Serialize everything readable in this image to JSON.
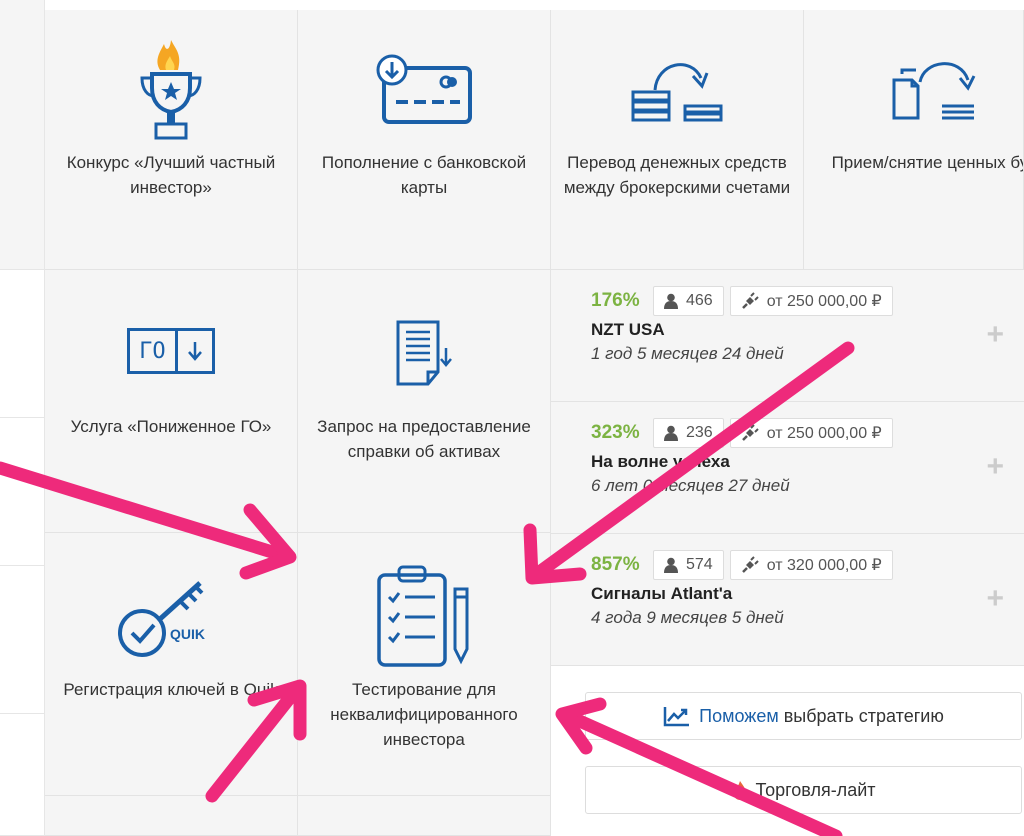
{
  "tiles": [
    {
      "label": "Конкурс «Лучший частный инвестор»",
      "icon": "trophy-icon"
    },
    {
      "label": "Пополнение с банковской карты",
      "icon": "bank-card-icon"
    },
    {
      "label": "Перевод денежных средств между брокерскими счетами",
      "icon": "money-transfer-icon"
    },
    {
      "label": "Прием/снятие ценных бумаг",
      "icon": "securities-transfer-icon"
    },
    {
      "label": "Услуга «Пониженное ГО»",
      "icon": "go-icon",
      "icon_text": "ГО"
    },
    {
      "label": "Запрос на предоставление справки об активах",
      "icon": "document-request-icon"
    },
    {
      "label": "Регистрация ключей в Quik",
      "icon": "quik-key-icon",
      "icon_text": "QUIK"
    },
    {
      "label": "Тестирование для неквалифицированного инвестора",
      "icon": "clipboard-test-icon"
    }
  ],
  "strategies": [
    {
      "percent": "176%",
      "subscribers": "466",
      "min_amount": "от 250 000,00 ₽",
      "name": "NZT USA",
      "duration": "1 год 5 месяцев 24 дней"
    },
    {
      "percent": "323%",
      "subscribers": "236",
      "min_amount": "от 250 000,00 ₽",
      "name": "На волне успеха",
      "duration": "6 лет 0 месяцев 27 дней"
    },
    {
      "percent": "857%",
      "subscribers": "574",
      "min_amount": "от 320 000,00 ₽",
      "name": "Сигналы Atlant'a",
      "duration": "4 года 9 месяцев 5 дней"
    }
  ],
  "plus_symbol": "+",
  "help_button": {
    "highlight": "Поможем",
    "rest": "выбрать стратегию",
    "icon": "chart-up-icon"
  },
  "lite_button": {
    "label": "Торговля-лайт",
    "icon": "flame-icon"
  },
  "colors": {
    "accent": "#1a5fa8",
    "percent": "#7cb342",
    "arrow": "#ee2a7b",
    "trophy_flame": "#f5a623"
  }
}
